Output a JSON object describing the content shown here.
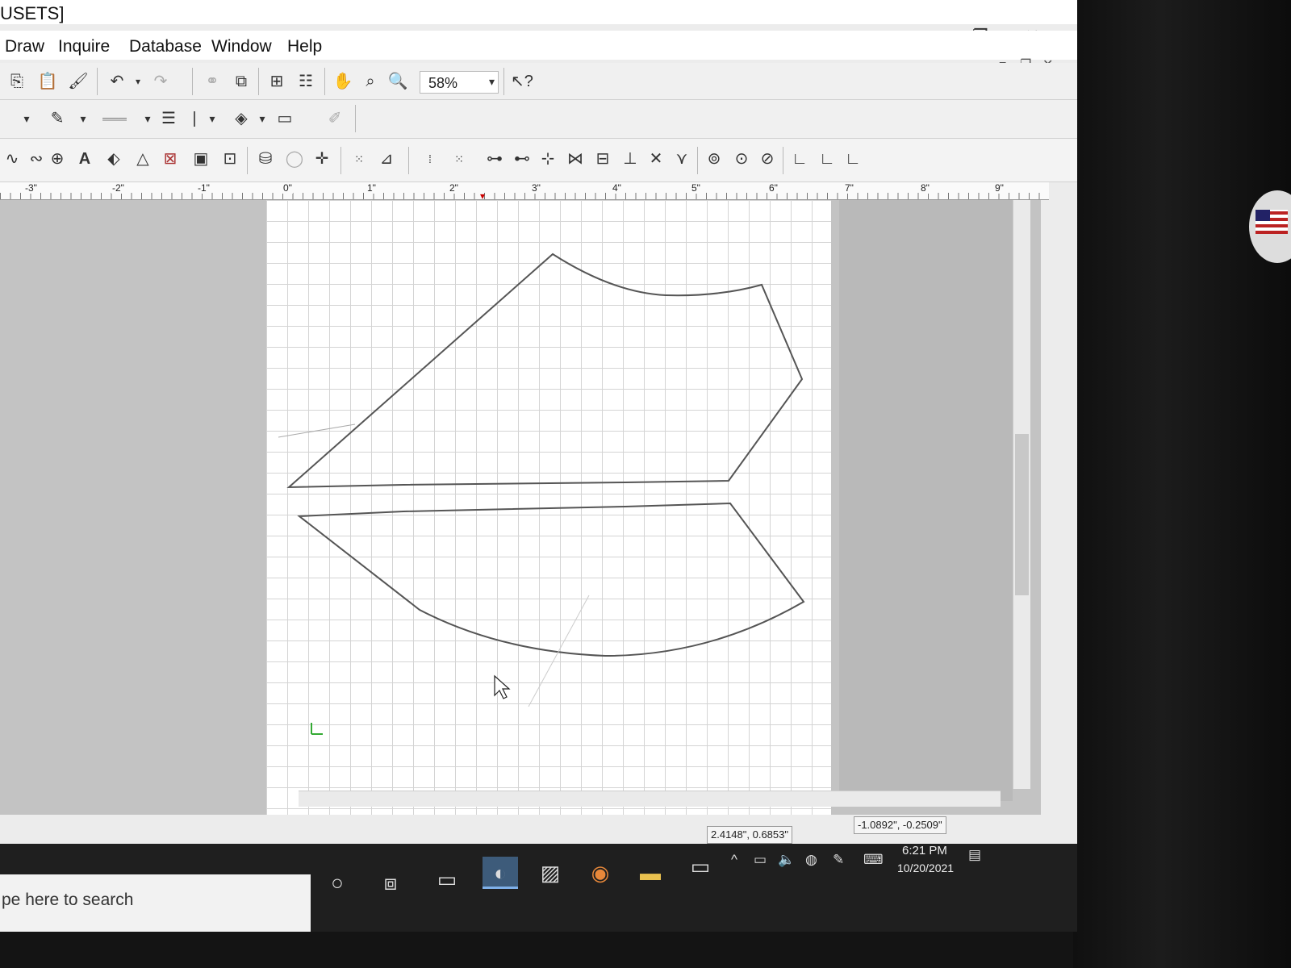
{
  "window": {
    "title": "USETS]",
    "minimize": "−",
    "restore": "❐",
    "close": "✕",
    "doc_minimize": "−",
    "doc_restore": "❐",
    "doc_close": "✕"
  },
  "menu": {
    "items": [
      "Draw",
      "Inquire",
      "Database",
      "Window",
      "Help"
    ]
  },
  "toolbar": {
    "zoom_value": "58%",
    "zoom_arrow": "▾",
    "help_icon": "help-pointer-icon"
  },
  "ruler": {
    "labels": [
      "-3\"",
      "-2\"",
      "-1\"",
      "0\"",
      "1\"",
      "2\"",
      "3\"",
      "4\"",
      "5\"",
      "6\"",
      "7\"",
      "8\"",
      "9\""
    ]
  },
  "status": {
    "cursor_coords": "2.4148\", 0.6853\"",
    "relative_coords": "-1.0892\", -0.2509\""
  },
  "taskbar": {
    "search_placeholder": "pe here to search",
    "time": "6:21 PM",
    "date": "10/20/2021"
  },
  "colors": {
    "workspace": "#c3c3c3",
    "paper": "#ffffff",
    "grid": "#d4d4d4",
    "outline": "#555555",
    "taskbar": "#1f1f1f"
  }
}
